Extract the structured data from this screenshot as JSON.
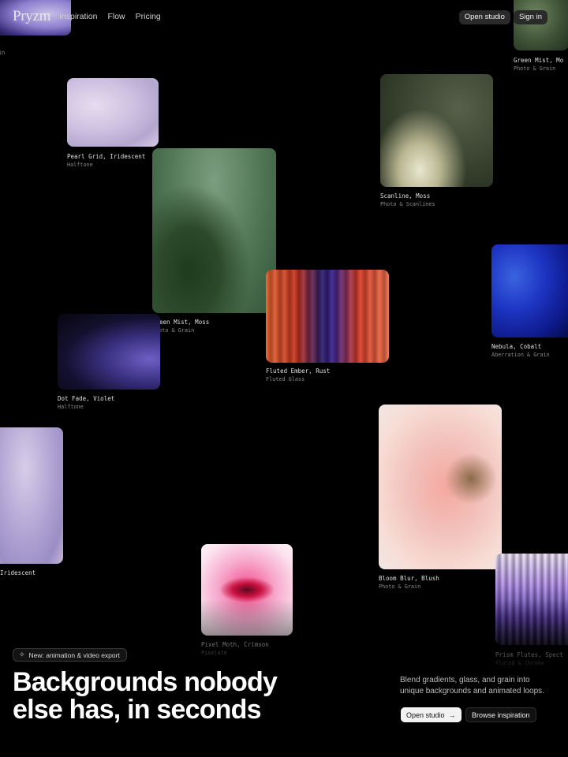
{
  "header": {
    "logo": "Pryzm",
    "nav": [
      {
        "label": "Inspiration"
      },
      {
        "label": "Flow"
      },
      {
        "label": "Pricing"
      }
    ],
    "open_studio": "Open studio",
    "sign_in": "Sign in"
  },
  "gallery": [
    {
      "title": "Green Mist, Mo",
      "subtitle": "Photo & Grain"
    },
    {
      "title": "t",
      "subtitle": "ain"
    },
    {
      "title": "Pearl Grid, Iridescent",
      "subtitle": "Halftone"
    },
    {
      "title": "Scanline, Moss",
      "subtitle": "Photo & Scanlines"
    },
    {
      "title": "Green Mist, Moss",
      "subtitle": "Photo & Grain"
    },
    {
      "title": "Nebula, Cobalt",
      "subtitle": "Aberration & Grain"
    },
    {
      "title": "Fluted Ember, Rust",
      "subtitle": "Fluted Glass"
    },
    {
      "title": "Dot Fade, Violet",
      "subtitle": "Halftone"
    },
    {
      "title": "Iridescent",
      "subtitle": ""
    },
    {
      "title": "Bloom Blur, Blush",
      "subtitle": "Photo & Grain"
    },
    {
      "title": "Pixel Moth, Crimson",
      "subtitle": "Pixelate"
    },
    {
      "title": "Prism Flutes, Spect",
      "subtitle": "Fluted & Chroma"
    }
  ],
  "hero": {
    "badge": "New: animation & video export",
    "headline_line1": "Backgrounds nobody",
    "headline_line2": "else has, in seconds",
    "subtext": "Blend gradients, glass, and grain into unique backgrounds and animated loops.",
    "primary_cta": "Open studio",
    "secondary_cta": "Browse inspiration"
  },
  "icons": {
    "badge": "sparkle-icon",
    "cta": "arrow-right-icon"
  }
}
